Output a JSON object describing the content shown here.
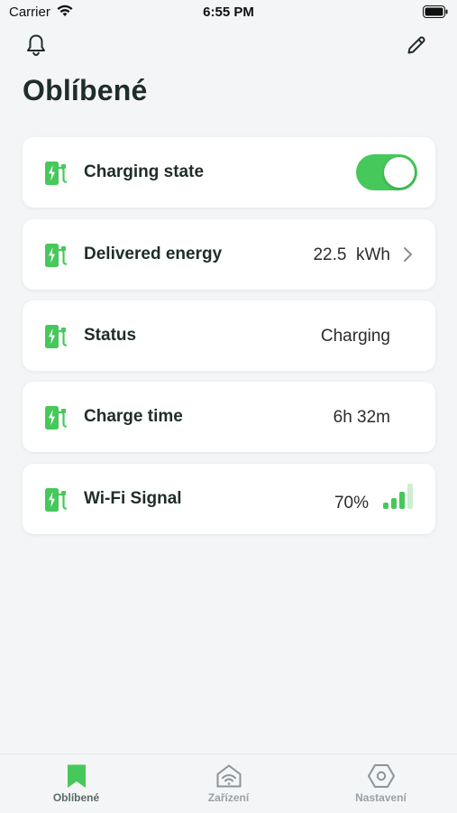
{
  "status_bar": {
    "carrier": "Carrier",
    "time": "6:55 PM"
  },
  "header": {
    "title": "Oblíbené",
    "icons": [
      "bell-icon",
      "pencil-icon"
    ]
  },
  "colors": {
    "accent": "#46c85a",
    "text": "#1f2d2a",
    "background": "#f4f5f6"
  },
  "cards": [
    {
      "label": "Charging state",
      "icon": "ev-charger-icon",
      "toggle_on": true
    },
    {
      "label": "Delivered energy",
      "icon": "ev-charger-icon",
      "value": "22.5  kWh"
    },
    {
      "label": "Status",
      "icon": "ev-charger-icon",
      "value": "Charging"
    },
    {
      "label": "Charge time",
      "icon": "ev-charger-icon",
      "value": "6h 32m"
    },
    {
      "label": "Wi-Fi Signal",
      "icon": "ev-charger-icon",
      "value": "70%",
      "signal_fraction": 0.7
    }
  ],
  "tabbar": {
    "tabs": [
      {
        "label": "Oblíbené",
        "icon": "bookmark-icon",
        "active": true
      },
      {
        "label": "Zařízení",
        "icon": "home-wifi-icon",
        "active": false
      },
      {
        "label": "Nastavení",
        "icon": "hexagon-settings-icon",
        "active": false
      }
    ]
  }
}
